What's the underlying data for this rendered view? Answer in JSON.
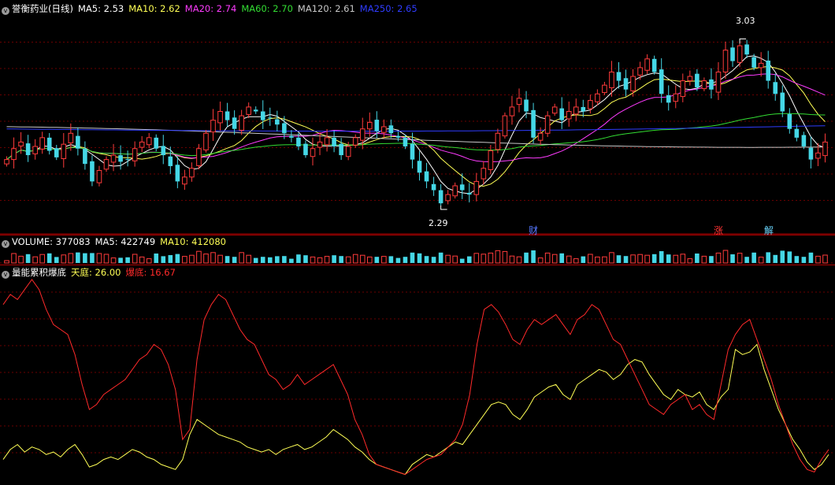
{
  "colors": {
    "up": "#ff3b3b",
    "down": "#45d7e6",
    "ma5": "#ffffff",
    "ma10": "#ffff55",
    "ma20": "#ff3bff",
    "ma60": "#33dd33",
    "ma120": "#c8c8c8",
    "ma250": "#2f3cff",
    "grid": "#6a0000",
    "border": "#b00000",
    "tianting": "#ffff55",
    "badi": "#ff2a2a",
    "badge_cai": "#5577ff",
    "badge_zhang": "#ff3333",
    "badge_jie": "#6ad7ff"
  },
  "price_panel": {
    "collapse_icon": "chevron-circle-icon",
    "title": "誉衡药业(日线)",
    "legend": [
      {
        "label": "MA5: 2.53",
        "color": "#ffffff"
      },
      {
        "label": "MA10: 2.62",
        "color": "#ffff55"
      },
      {
        "label": "MA20: 2.74",
        "color": "#ff3bff"
      },
      {
        "label": "MA60: 2.70",
        "color": "#33dd33"
      },
      {
        "label": "MA120: 2.61",
        "color": "#c8c8c8"
      },
      {
        "label": "MA250: 2.65",
        "color": "#2f3cff"
      }
    ],
    "high_label": "3.03",
    "low_label": "2.29",
    "badges": {
      "cai": "财",
      "zhang": "涨",
      "jie": "解"
    }
  },
  "volume_panel": {
    "title": "VOLUME: 377083",
    "ma5": "MA5: 422749",
    "ma10": "MA10: 412080"
  },
  "indicator_panel": {
    "title": "量能累积爆底",
    "tianting": "天庭: 26.00",
    "badi": "爆底: 16.67"
  },
  "chart_data": [
    {
      "type": "candlestick",
      "title": "誉衡药业(日线)",
      "ylim": [
        2.2,
        3.15
      ],
      "high": 3.03,
      "low": 2.29,
      "close": [
        2.5,
        2.55,
        2.58,
        2.52,
        2.56,
        2.6,
        2.54,
        2.51,
        2.57,
        2.62,
        2.55,
        2.48,
        2.4,
        2.45,
        2.5,
        2.52,
        2.49,
        2.5,
        2.55,
        2.58,
        2.6,
        2.55,
        2.52,
        2.47,
        2.4,
        2.42,
        2.46,
        2.55,
        2.62,
        2.68,
        2.72,
        2.68,
        2.64,
        2.7,
        2.74,
        2.72,
        2.68,
        2.69,
        2.66,
        2.62,
        2.6,
        2.56,
        2.52,
        2.55,
        2.58,
        2.6,
        2.56,
        2.52,
        2.56,
        2.6,
        2.64,
        2.67,
        2.63,
        2.65,
        2.62,
        2.6,
        2.56,
        2.5,
        2.44,
        2.4,
        2.36,
        2.3,
        2.34,
        2.38,
        2.36,
        2.34,
        2.4,
        2.46,
        2.54,
        2.62,
        2.7,
        2.74,
        2.78,
        2.72,
        2.6,
        2.62,
        2.7,
        2.74,
        2.68,
        2.72,
        2.74,
        2.72,
        2.77,
        2.8,
        2.84,
        2.9,
        2.86,
        2.82,
        2.88,
        2.92,
        2.96,
        2.9,
        2.8,
        2.76,
        2.8,
        2.86,
        2.88,
        2.83,
        2.86,
        2.82,
        2.9,
        3.0,
        2.95,
        3.02,
        2.98,
        2.92,
        2.94,
        2.86,
        2.8,
        2.72,
        2.64,
        2.6,
        2.56,
        2.5,
        2.53,
        2.58
      ]
    },
    {
      "type": "bar",
      "title": "VOLUME",
      "values": [
        377083
      ],
      "ma5": 422749,
      "ma10": 412080
    },
    {
      "type": "line",
      "title": "量能累积爆底",
      "series": [
        {
          "name": "天庭",
          "values": [
            8,
            12,
            14,
            11,
            13,
            12,
            10,
            11,
            9,
            12,
            14,
            10,
            5,
            6,
            8,
            9,
            8,
            10,
            12,
            11,
            9,
            8,
            6,
            5,
            4,
            8,
            18,
            24,
            22,
            20,
            18,
            17,
            16,
            15,
            13,
            12,
            11,
            12,
            10,
            12,
            13,
            14,
            12,
            13,
            15,
            17,
            20,
            18,
            16,
            13,
            11,
            8,
            6,
            5,
            4,
            3,
            2,
            6,
            8,
            10,
            9,
            11,
            13,
            15,
            14,
            18,
            22,
            26,
            30,
            31,
            30,
            26,
            24,
            28,
            33,
            35,
            37,
            38,
            34,
            32,
            38,
            40,
            42,
            44,
            43,
            40,
            42,
            46,
            48,
            47,
            42,
            38,
            34,
            32,
            36,
            34,
            33,
            35,
            30,
            28,
            33,
            36,
            52,
            50,
            51,
            54,
            44,
            36,
            28,
            22,
            16,
            12,
            7,
            4,
            6,
            10
          ]
        },
        {
          "name": "爆底",
          "values": [
            70,
            74,
            72,
            76,
            80,
            76,
            68,
            62,
            60,
            58,
            50,
            38,
            28,
            30,
            34,
            36,
            38,
            40,
            44,
            48,
            50,
            54,
            52,
            46,
            36,
            16,
            20,
            48,
            64,
            70,
            74,
            72,
            66,
            60,
            56,
            54,
            48,
            42,
            40,
            36,
            38,
            42,
            38,
            40,
            42,
            44,
            46,
            40,
            34,
            24,
            18,
            10,
            6,
            5,
            4,
            3,
            2,
            4,
            6,
            8,
            9,
            10,
            13,
            16,
            22,
            34,
            54,
            68,
            70,
            67,
            62,
            56,
            54,
            60,
            64,
            62,
            64,
            66,
            62,
            58,
            64,
            66,
            70,
            68,
            62,
            56,
            54,
            48,
            42,
            36,
            30,
            28,
            26,
            30,
            32,
            34,
            28,
            30,
            26,
            24,
            38,
            52,
            58,
            62,
            64,
            56,
            48,
            40,
            30,
            22,
            14,
            8,
            4,
            3,
            8,
            12
          ]
        }
      ]
    }
  ]
}
